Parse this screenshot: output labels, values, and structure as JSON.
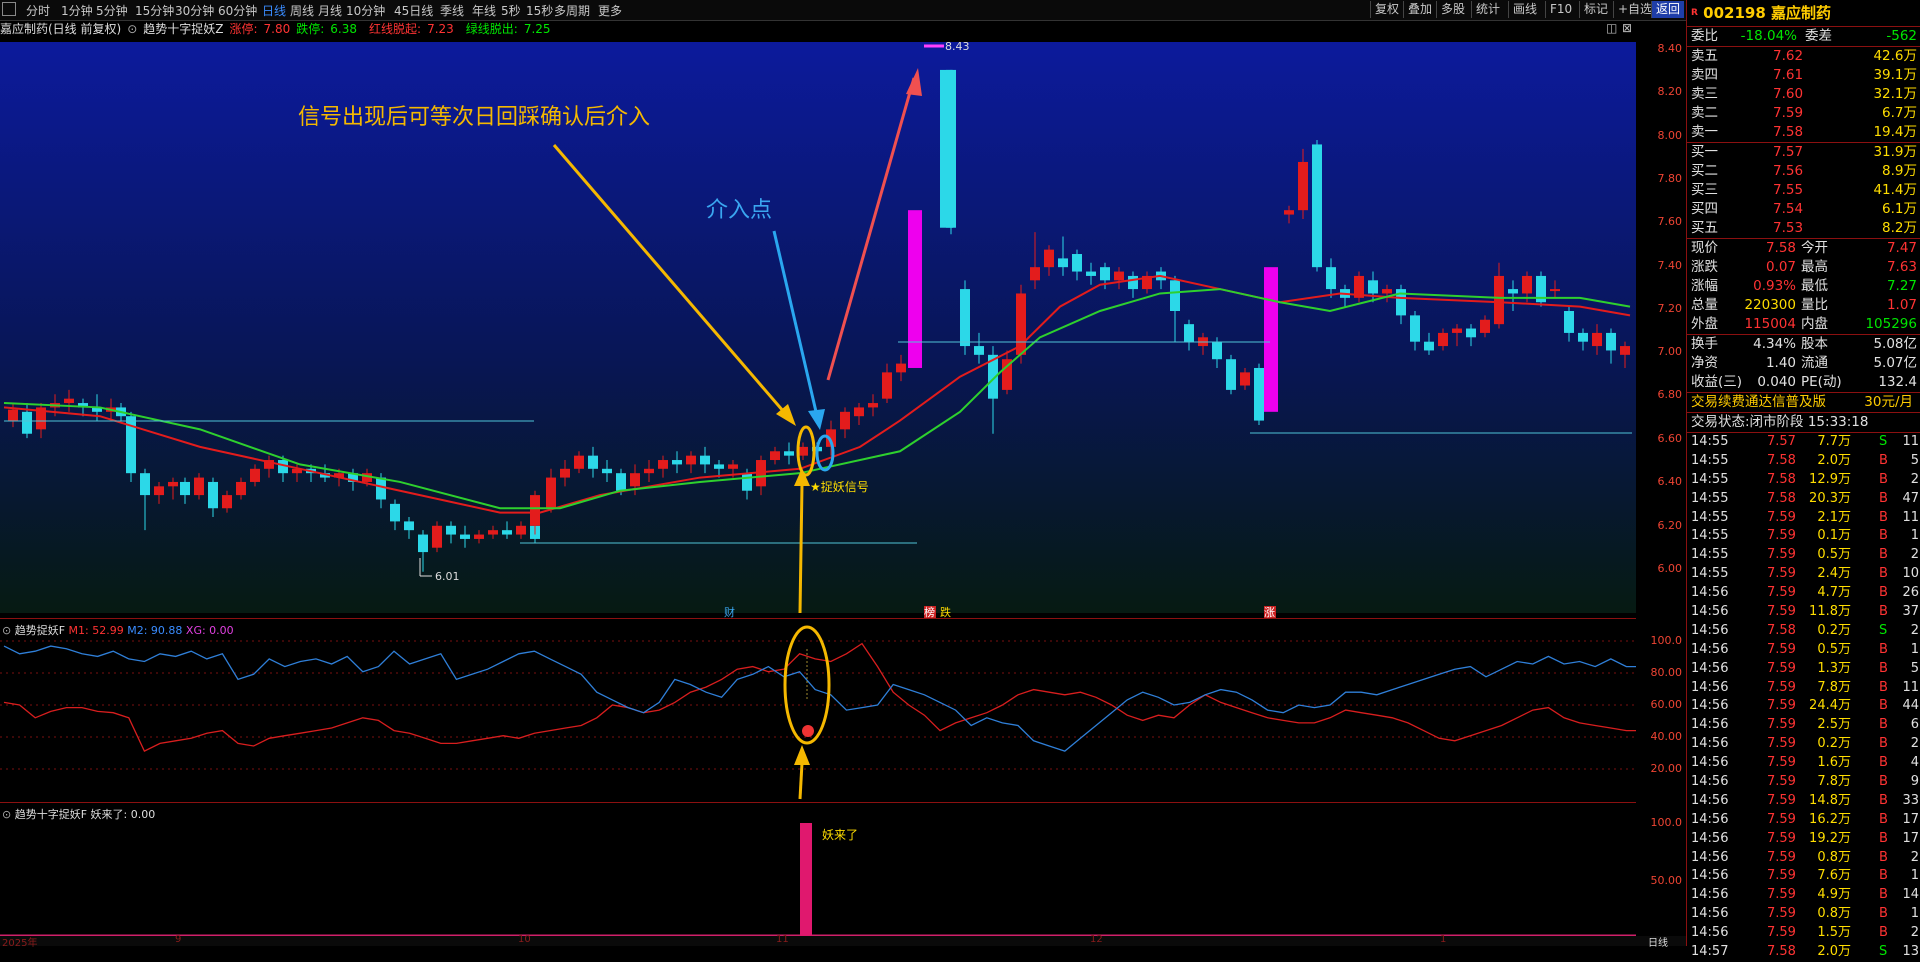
{
  "toolbar": {
    "periods": [
      "分时",
      "1分钟",
      "5分钟",
      "15分钟",
      "30分钟",
      "60分钟",
      "日线",
      "周线",
      "月线",
      "10分钟",
      "45日线",
      "季线",
      "年线",
      "5秒",
      "15秒",
      "多周期",
      "更多"
    ],
    "active_period": "日线",
    "right_buttons": [
      "复权",
      "叠加",
      "多股",
      "统计",
      "画线",
      "F10",
      "标记",
      "+自选",
      "返回"
    ]
  },
  "title_bar": {
    "stock": "嘉应制药(日线 前复权)",
    "indicator": "趋势十字捉妖Z",
    "limit_up_label": "涨停:",
    "limit_up": "7.80",
    "limit_down_label": "跌停:",
    "limit_down": "6.38",
    "red_breakout_label": "红线脱起:",
    "red_breakout": "7.23",
    "green_breakout_label": "绿线脱出:",
    "green_breakout": "7.25"
  },
  "main_chart": {
    "annotation_main": "信号出现后可等次日回踩确认后介入",
    "annotation_entry": "介入点",
    "signal_label": "★捉妖信号",
    "high_label": "8.43",
    "low_label": "6.01",
    "event_labels": [
      "财",
      "榜",
      "跌",
      "涨"
    ],
    "y_ticks": [
      "8.40",
      "8.20",
      "8.00",
      "7.80",
      "7.60",
      "7.40",
      "7.20",
      "7.00",
      "6.80",
      "6.60",
      "6.40",
      "6.20",
      "6.00"
    ]
  },
  "sub_chart1": {
    "name": "趋势捉妖F",
    "m1_label": "M1: 52.99",
    "m2_label": "M2: 90.88",
    "xg_label": "XG: 0.00",
    "y_ticks": [
      "100.0",
      "80.00",
      "60.00",
      "40.00",
      "20.00"
    ]
  },
  "sub_chart2": {
    "name": "趋势十字捉妖F",
    "value_label": "妖来了: 0.00",
    "bar_label": "妖来了",
    "y_ticks": [
      "100.0",
      "50.00"
    ]
  },
  "x_axis": {
    "labels": [
      "2025年",
      "9",
      "10",
      "11",
      "12",
      "1"
    ],
    "period_tag": "日线"
  },
  "quote": {
    "code": "002198",
    "name": "嘉应制药",
    "wb_label": "委比",
    "wb": "-18.04%",
    "wc_label": "委差",
    "wc": "-562",
    "asks": [
      {
        "label": "卖五",
        "price": "7.62",
        "vol": "42.6万"
      },
      {
        "label": "卖四",
        "price": "7.61",
        "vol": "39.1万"
      },
      {
        "label": "卖三",
        "price": "7.60",
        "vol": "32.1万"
      },
      {
        "label": "卖二",
        "price": "7.59",
        "vol": "6.7万"
      },
      {
        "label": "卖一",
        "price": "7.58",
        "vol": "19.4万"
      }
    ],
    "bids": [
      {
        "label": "买一",
        "price": "7.57",
        "vol": "31.9万"
      },
      {
        "label": "买二",
        "price": "7.56",
        "vol": "8.9万"
      },
      {
        "label": "买三",
        "price": "7.55",
        "vol": "41.4万"
      },
      {
        "label": "买四",
        "price": "7.54",
        "vol": "6.1万"
      },
      {
        "label": "买五",
        "price": "7.53",
        "vol": "8.2万"
      }
    ],
    "stats": [
      {
        "l1": "现价",
        "v1": "7.58",
        "l2": "今开",
        "v2": "7.47"
      },
      {
        "l1": "涨跌",
        "v1": "0.07",
        "l2": "最高",
        "v2": "7.63"
      },
      {
        "l1": "涨幅",
        "v1": "0.93%",
        "l2": "最低",
        "v2": "7.27"
      },
      {
        "l1": "总量",
        "v1": "220300",
        "l2": "量比",
        "v2": "1.07"
      },
      {
        "l1": "外盘",
        "v1": "115004",
        "l2": "内盘",
        "v2": "105296"
      }
    ],
    "info": [
      {
        "l1": "换手",
        "v1": "4.34%",
        "l2": "股本",
        "v2": "5.08亿"
      },
      {
        "l1": "净资",
        "v1": "1.40",
        "l2": "流通",
        "v2": "5.07亿"
      },
      {
        "l1": "收益(三)",
        "v1": "0.040",
        "l2": "PE(动)",
        "v2": "132.4"
      }
    ],
    "promo": "交易续费通达信普及版",
    "promo_price": "30元/月",
    "status": "交易状态:闭市阶段 15:33:18"
  },
  "ticks": [
    {
      "t": "14:55",
      "p": "7.57",
      "v": "7.7万",
      "d": "S",
      "n": "11"
    },
    {
      "t": "14:55",
      "p": "7.58",
      "v": "2.0万",
      "d": "B",
      "n": "5"
    },
    {
      "t": "14:55",
      "p": "7.58",
      "v": "12.9万",
      "d": "B",
      "n": "2"
    },
    {
      "t": "14:55",
      "p": "7.58",
      "v": "20.3万",
      "d": "B",
      "n": "47"
    },
    {
      "t": "14:55",
      "p": "7.59",
      "v": "2.1万",
      "d": "B",
      "n": "11"
    },
    {
      "t": "14:55",
      "p": "7.59",
      "v": "0.1万",
      "d": "B",
      "n": "1"
    },
    {
      "t": "14:55",
      "p": "7.59",
      "v": "0.5万",
      "d": "B",
      "n": "2"
    },
    {
      "t": "14:55",
      "p": "7.59",
      "v": "2.4万",
      "d": "B",
      "n": "10"
    },
    {
      "t": "14:56",
      "p": "7.59",
      "v": "4.7万",
      "d": "B",
      "n": "26"
    },
    {
      "t": "14:56",
      "p": "7.59",
      "v": "11.8万",
      "d": "B",
      "n": "37"
    },
    {
      "t": "14:56",
      "p": "7.58",
      "v": "0.2万",
      "d": "S",
      "n": "2"
    },
    {
      "t": "14:56",
      "p": "7.59",
      "v": "0.5万",
      "d": "B",
      "n": "1"
    },
    {
      "t": "14:56",
      "p": "7.59",
      "v": "1.3万",
      "d": "B",
      "n": "5"
    },
    {
      "t": "14:56",
      "p": "7.59",
      "v": "7.8万",
      "d": "B",
      "n": "11"
    },
    {
      "t": "14:56",
      "p": "7.59",
      "v": "24.4万",
      "d": "B",
      "n": "44"
    },
    {
      "t": "14:56",
      "p": "7.59",
      "v": "2.5万",
      "d": "B",
      "n": "6"
    },
    {
      "t": "14:56",
      "p": "7.59",
      "v": "0.2万",
      "d": "B",
      "n": "2"
    },
    {
      "t": "14:56",
      "p": "7.59",
      "v": "1.6万",
      "d": "B",
      "n": "4"
    },
    {
      "t": "14:56",
      "p": "7.59",
      "v": "7.8万",
      "d": "B",
      "n": "9"
    },
    {
      "t": "14:56",
      "p": "7.59",
      "v": "14.8万",
      "d": "B",
      "n": "33"
    },
    {
      "t": "14:56",
      "p": "7.59",
      "v": "16.2万",
      "d": "B",
      "n": "17"
    },
    {
      "t": "14:56",
      "p": "7.59",
      "v": "19.2万",
      "d": "B",
      "n": "17"
    },
    {
      "t": "14:56",
      "p": "7.59",
      "v": "0.8万",
      "d": "B",
      "n": "2"
    },
    {
      "t": "14:56",
      "p": "7.59",
      "v": "7.6万",
      "d": "B",
      "n": "1"
    },
    {
      "t": "14:56",
      "p": "7.59",
      "v": "4.9万",
      "d": "B",
      "n": "14"
    },
    {
      "t": "14:56",
      "p": "7.59",
      "v": "0.8万",
      "d": "B",
      "n": "1"
    },
    {
      "t": "14:56",
      "p": "7.59",
      "v": "1.5万",
      "d": "B",
      "n": "2"
    },
    {
      "t": "14:57",
      "p": "7.58",
      "v": "2.0万",
      "d": "S",
      "n": "13"
    }
  ]
}
